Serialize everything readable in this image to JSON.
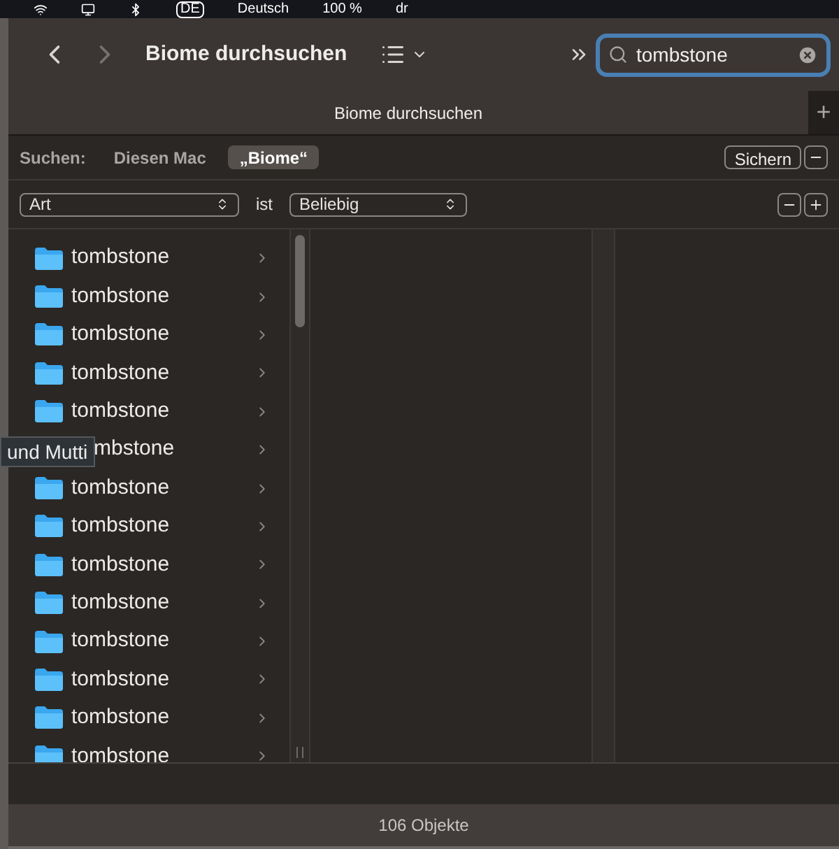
{
  "menu_bar": {
    "items": [
      "DE",
      "Deutsch",
      "100 %",
      "dr"
    ]
  },
  "toolbar": {
    "title": "Biome durchsuchen",
    "search": {
      "value": "tombstone"
    }
  },
  "tab_bar": {
    "tabs": [
      {
        "label": "Biome durchsuchen",
        "selected": true
      }
    ],
    "add_label": "+"
  },
  "scope_bar": {
    "label": "Suchen:",
    "scopes": [
      {
        "label": "Diesen Mac",
        "selected": false
      },
      {
        "label": "„Biome“",
        "selected": true
      }
    ],
    "save": "Sichern"
  },
  "criteria": {
    "attribute": "Art",
    "operator": "ist",
    "value": "Beliebig"
  },
  "results": [
    {
      "kind": "folder",
      "name": "tombstone"
    },
    {
      "kind": "folder",
      "name": "tombstone"
    },
    {
      "kind": "folder",
      "name": "tombstone"
    },
    {
      "kind": "folder",
      "name": "tombstone"
    },
    {
      "kind": "folder",
      "name": "tombstone"
    },
    {
      "kind": "covered",
      "name": "mbstone"
    },
    {
      "kind": "folder",
      "name": "tombstone"
    },
    {
      "kind": "folder",
      "name": "tombstone"
    },
    {
      "kind": "folder",
      "name": "tombstone"
    },
    {
      "kind": "folder",
      "name": "tombstone"
    },
    {
      "kind": "folder",
      "name": "tombstone"
    },
    {
      "kind": "folder",
      "name": "tombstone"
    },
    {
      "kind": "folder",
      "name": "tombstone"
    },
    {
      "kind": "folder",
      "name": "tombstone"
    }
  ],
  "tooltip": "und Mutti",
  "status_bar": {
    "text": "106 Objekte"
  }
}
